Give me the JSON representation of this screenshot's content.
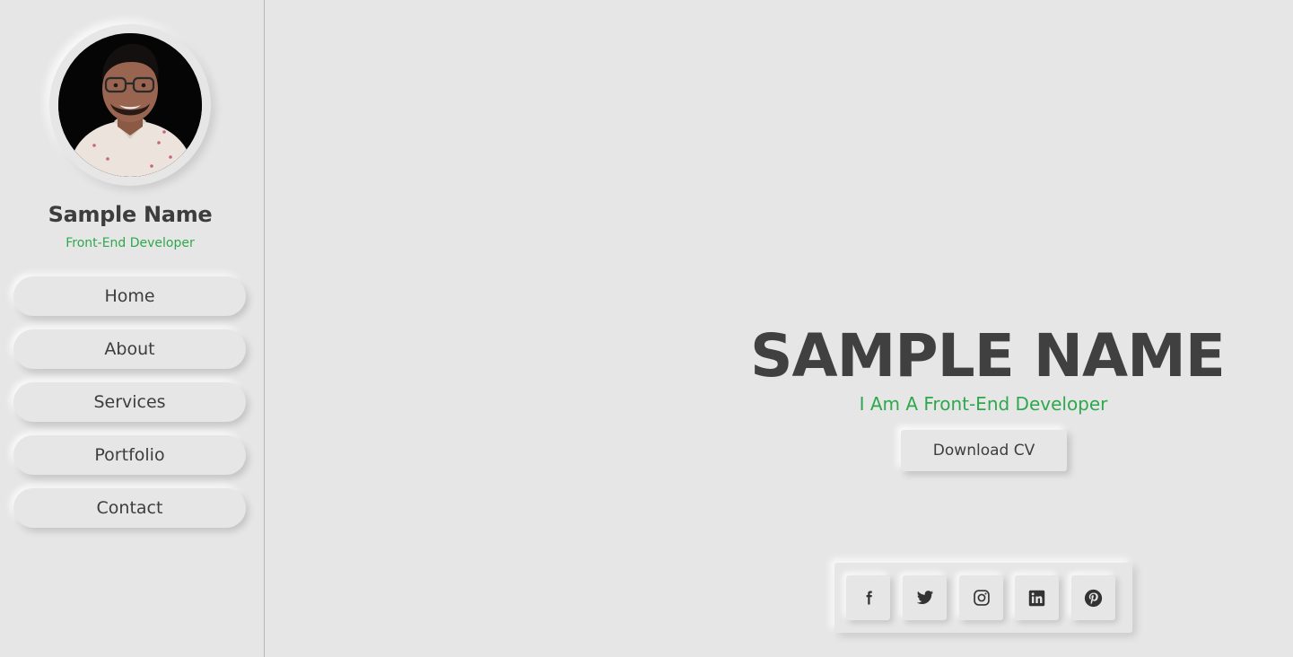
{
  "profile": {
    "name": "Sample Name",
    "role": "Front-End Developer",
    "avatar_alt": "profile photo"
  },
  "nav": {
    "items": [
      {
        "label": "Home"
      },
      {
        "label": "About"
      },
      {
        "label": "Services"
      },
      {
        "label": "Portfolio"
      },
      {
        "label": "Contact"
      }
    ]
  },
  "hero": {
    "title": "SAMPLE NAME",
    "subtitle": "I Am A Front-End Developer",
    "cv_button": "Download CV"
  },
  "social": {
    "icons": [
      "facebook-icon",
      "twitter-icon",
      "instagram-icon",
      "linkedin-icon",
      "pinterest-icon"
    ]
  },
  "colors": {
    "background": "#e6e6e6",
    "accent": "#2ea84c",
    "text": "#404040"
  }
}
